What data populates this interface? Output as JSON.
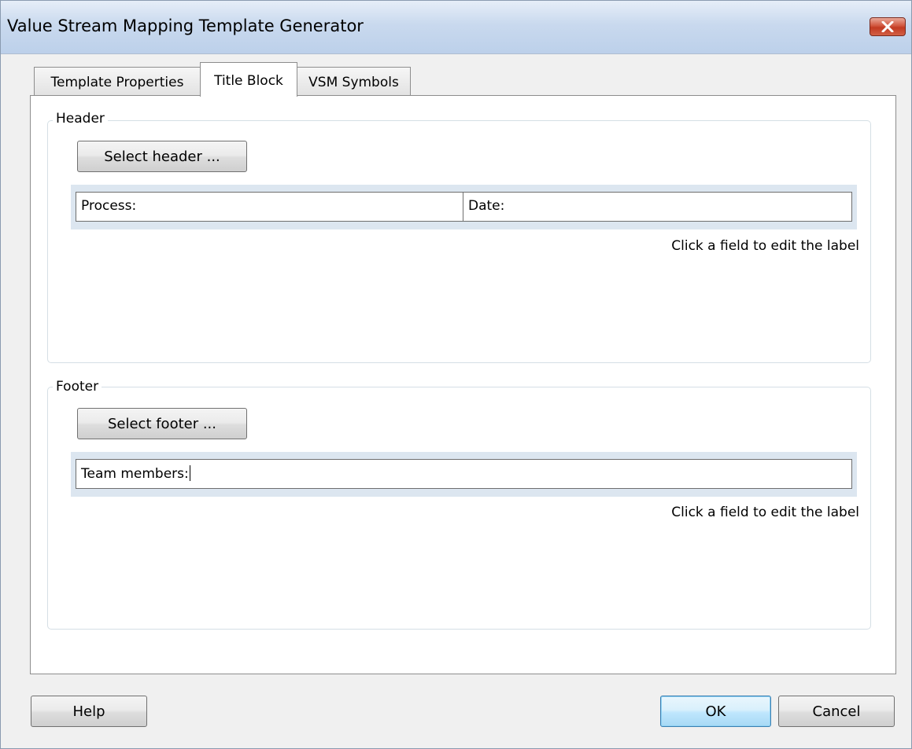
{
  "window": {
    "title": "Value Stream Mapping Template Generator",
    "close_icon": "close-x-icon"
  },
  "tabs": [
    {
      "label": "Template Properties",
      "active": false
    },
    {
      "label": "Title Block",
      "active": true
    },
    {
      "label": "VSM Symbols",
      "active": false
    }
  ],
  "header": {
    "legend": "Header",
    "select_button": "Select header ...",
    "fields": [
      "Process:",
      "Date:"
    ],
    "hint": "Click a field to edit the label"
  },
  "footer": {
    "legend": "Footer",
    "select_button": "Select footer ...",
    "fields": [
      "Team members:"
    ],
    "hint": "Click a field to edit the label"
  },
  "buttons": {
    "help": "Help",
    "ok": "OK",
    "cancel": "Cancel"
  },
  "colors": {
    "titlebar": "#c9d9ee",
    "close_button": "#c23a22",
    "field_strip": "#dce6f0",
    "default_button": "#bee6fd"
  }
}
